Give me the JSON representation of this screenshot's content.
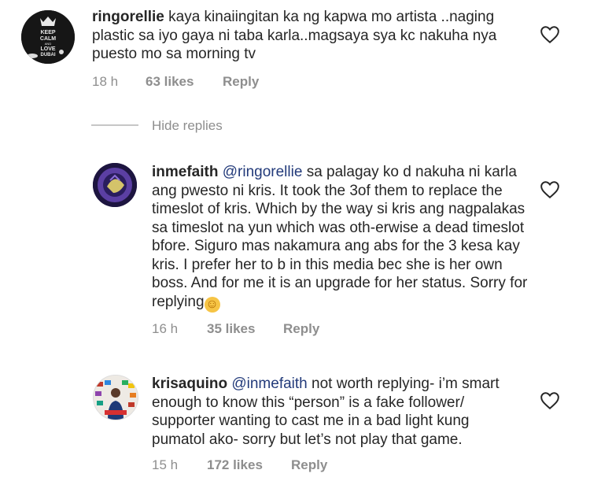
{
  "comments": [
    {
      "username": "ringorellie",
      "text": "kaya kinaiingitan ka ng kapwa mo artista ..naging plastic sa iyo gaya ni  taba karla..magsaya sya kc nakuha nya puesto mo sa morning tv",
      "time": "18 h",
      "likes": "63 likes",
      "reply": "Reply",
      "avatar_text": [
        "KEEP",
        "CALM",
        "AND",
        "LOVE",
        "DUBAI"
      ]
    },
    {
      "username": "inmefaith",
      "mention": "@ringorellie",
      "text": "sa palagay ko d nakuha ni karla ang pwesto ni kris. It took the 3of them to replace the timeslot of kris. Which by the way si kris ang nagpalakas sa timeslot na yun which was oth-erwise a dead timeslot bfore. Siguro mas nakamura ang abs for the 3 kesa kay kris. I prefer her to b in this media bec she is her own boss. And for me it is an upgrade for her status. Sorry for replying",
      "emoji": "☺",
      "time": "16 h",
      "likes": "35 likes",
      "reply": "Reply"
    },
    {
      "username": "krisaquino",
      "mention": "@inmefaith",
      "text": "not worth replying- i’m smart enough to know this “person” is a fake follower/ supporter wanting to cast me in a bad light kung pumatol ako- sorry but let’s not play that game.",
      "time": "15 h",
      "likes": "172 likes",
      "reply": "Reply"
    }
  ],
  "hide_replies": "Hide replies",
  "icons": {
    "like": "heart-outline-icon"
  }
}
